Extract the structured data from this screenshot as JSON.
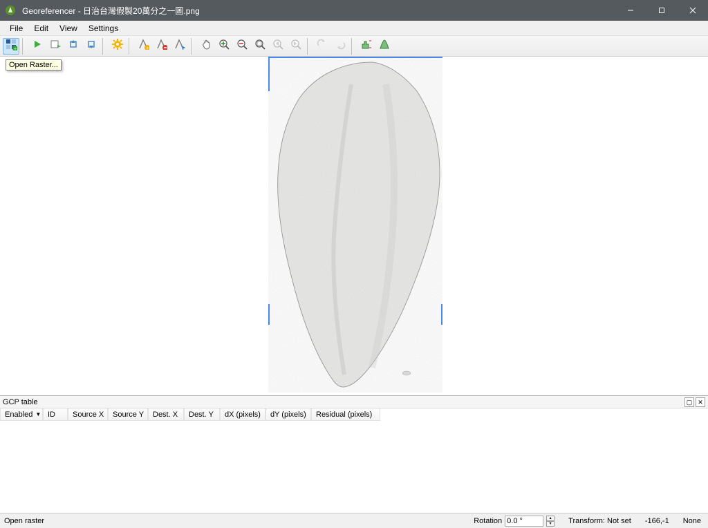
{
  "window": {
    "title": "Georeferencer - 日治台灣假製20萬分之一圖.png"
  },
  "menu": {
    "file": "File",
    "edit": "Edit",
    "view": "View",
    "settings": "Settings"
  },
  "tooltip": {
    "open_raster": "Open Raster..."
  },
  "gcp": {
    "panel_title": "GCP table",
    "columns": {
      "enabled": "Enabled",
      "id": "ID",
      "source_x": "Source X",
      "source_y": "Source Y",
      "dest_x": "Dest. X",
      "dest_y": "Dest. Y",
      "dx": "dX (pixels)",
      "dy": "dY (pixels)",
      "residual": "Residual (pixels)"
    }
  },
  "statusbar": {
    "message": "Open raster",
    "rotation_label": "Rotation",
    "rotation_value": "0.0 °",
    "transform_label": "Transform: Not set",
    "coords": "-166,-1",
    "extra": "None"
  },
  "icons": {
    "open_raster": "open-raster-icon",
    "start": "play-icon",
    "save_gcp": "save-gcp-icon",
    "load_gcp": "load-gcp-icon",
    "export": "export-icon",
    "transform_settings": "gear-icon",
    "add_point": "add-point-icon",
    "delete_point": "delete-point-icon",
    "move_point": "move-point-icon",
    "pan": "pan-icon",
    "zoom_in": "zoom-in-icon",
    "zoom_out": "zoom-out-icon",
    "zoom_layer": "zoom-layer-icon",
    "zoom_last": "zoom-last-icon",
    "zoom_next": "zoom-next-icon",
    "link_georef": "link-georef-icon",
    "link_qgis": "link-qgis-icon",
    "histogram1": "histogram-icon",
    "histogram2": "histogram-stretch-icon"
  }
}
